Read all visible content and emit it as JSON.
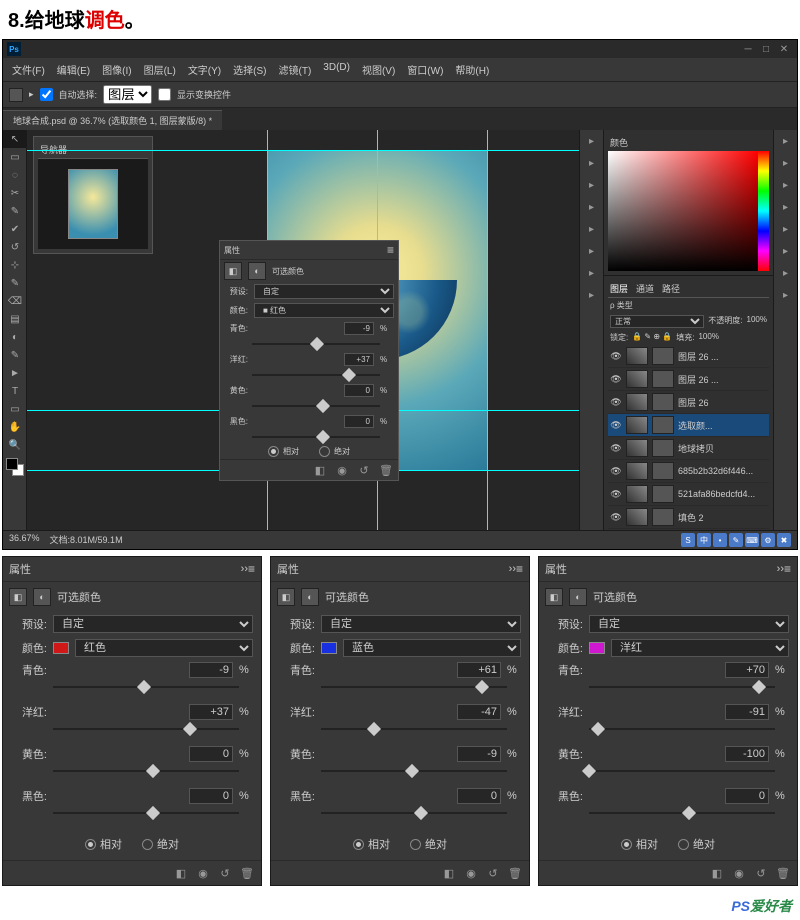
{
  "step": {
    "num": "8.",
    "prefix": "给地球",
    "accent": "调色",
    "suffix": "。"
  },
  "menus": [
    "文件(F)",
    "编辑(E)",
    "图像(I)",
    "图层(L)",
    "文字(Y)",
    "选择(S)",
    "滤镜(T)",
    "3D(D)",
    "视图(V)",
    "窗口(W)",
    "帮助(H)"
  ],
  "optbar": {
    "auto": "自动选择:",
    "layer": "图层",
    "show": "显示变换控件"
  },
  "doctab": "地球合成.psd @ 36.7% (选取颜色 1, 图层蒙版/8) *",
  "navigator": {
    "title": "导航器"
  },
  "status": {
    "zoom": "36.67%",
    "doc": "文档:8.01M/59.1M"
  },
  "colorPanel": {
    "title": "颜色"
  },
  "layersPanel": {
    "tabs": [
      "图层",
      "通道",
      "路径"
    ],
    "kind": "ρ 类型",
    "blend": "正常",
    "opacity": "不透明度:",
    "opVal": "100%",
    "lock": "锁定:",
    "fill": "填充:",
    "fillVal": "100%",
    "items": [
      {
        "name": "图层 26 ..."
      },
      {
        "name": "图层 26 ..."
      },
      {
        "name": "图层 26"
      },
      {
        "name": "选取颜..."
      },
      {
        "name": "地球拷贝"
      },
      {
        "name": "685b2b32d6f446..."
      },
      {
        "name": "521afa86bedcfd4..."
      },
      {
        "name": "填色 2"
      }
    ]
  },
  "propsCommon": {
    "title": "属性",
    "type": "可选颜色",
    "presetLabel": "预设:",
    "preset": "自定",
    "colorLabel": "颜色:",
    "cyan": "青色:",
    "magenta": "洋红:",
    "yellow": "黄色:",
    "black": "黑色:",
    "pct": "%",
    "relative": "相对",
    "absolute": "绝对"
  },
  "floatProps": {
    "colorName": "红色",
    "swatch": "#d01818",
    "cyan": "-9",
    "magenta": "+37",
    "yellow": "0",
    "black": "0"
  },
  "panels": [
    {
      "colorName": "红色",
      "swatch": "#d01818",
      "cyan": "-9",
      "magenta": "+37",
      "yellow": "0",
      "black": "0"
    },
    {
      "colorName": "蓝色",
      "swatch": "#1830e0",
      "cyan": "+61",
      "magenta": "-47",
      "yellow": "-9",
      "black": "0"
    },
    {
      "colorName": "洋红",
      "swatch": "#d018d0",
      "cyan": "+70",
      "magenta": "-91",
      "yellow": "-100",
      "black": "0"
    }
  ],
  "watermark": {
    "ps": "PS",
    "txt": "爱好者"
  }
}
